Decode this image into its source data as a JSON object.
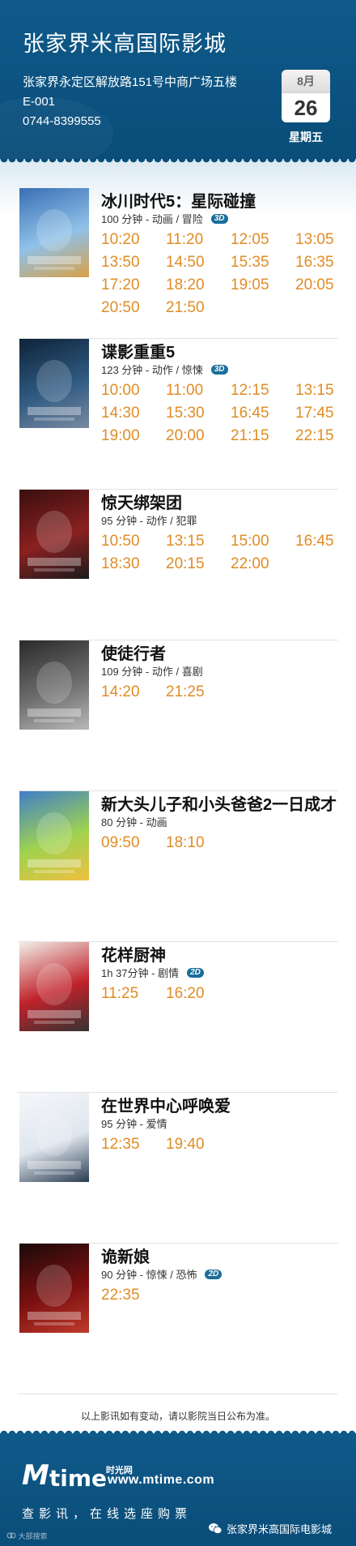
{
  "header": {
    "cinema_name": "张家界米高国际影城",
    "address": "张家界永定区解放路151号中商广场五楼E-001",
    "phone": "0744-8399555",
    "calendar": {
      "month": "8月",
      "day": "26",
      "weekday": "星期五"
    }
  },
  "movies": [
    {
      "title": "冰川时代5：星际碰撞",
      "info": "100 分钟 - 动画 / 冒险",
      "badge": "3D",
      "poster": "ice-age-poster",
      "times": [
        "10:20",
        "11:20",
        "12:05",
        "13:05",
        "13:50",
        "14:50",
        "15:35",
        "16:35",
        "17:20",
        "18:20",
        "19:05",
        "20:05",
        "20:50",
        "21:50"
      ]
    },
    {
      "title": "谍影重重5",
      "info": "123 分钟 - 动作 / 惊悚",
      "badge": "3D",
      "poster": "jason-bourne-poster",
      "times": [
        "10:00",
        "11:00",
        "12:15",
        "13:15",
        "14:30",
        "15:30",
        "16:45",
        "17:45",
        "19:00",
        "20:00",
        "21:15",
        "22:15"
      ]
    },
    {
      "title": "惊天绑架团",
      "info": "95 分钟 - 动作 / 犯罪",
      "badge": "",
      "poster": "kidnapping-poster",
      "times": [
        "10:50",
        "13:15",
        "15:00",
        "16:45",
        "18:30",
        "20:15",
        "22:00"
      ]
    },
    {
      "title": "使徒行者",
      "info": "109 分钟 - 动作 / 喜剧",
      "badge": "",
      "poster": "line-walker-poster",
      "times": [
        "14:20",
        "21:25"
      ]
    },
    {
      "title": "新大头儿子和小头爸爸2一日成才",
      "info": "80 分钟 - 动画",
      "badge": "",
      "poster": "big-head-son-poster",
      "times": [
        "09:50",
        "18:10"
      ]
    },
    {
      "title": "花样厨神",
      "info": "1h 37分钟 - 剧情",
      "badge": "2D",
      "poster": "chef-poster",
      "times": [
        "11:25",
        "16:20"
      ]
    },
    {
      "title": "在世界中心呼唤爱",
      "info": "95 分钟 - 爱情",
      "badge": "",
      "poster": "crying-out-love-poster",
      "times": [
        "12:35",
        "19:40"
      ]
    },
    {
      "title": "诡新娘",
      "info": "90 分钟 - 惊悚 / 恐怖",
      "badge": "2D",
      "poster": "ghost-bride-poster",
      "times": [
        "22:35"
      ]
    }
  ],
  "notice": "以上影讯如有变动，请以影院当日公布为准。",
  "footer": {
    "logo_m": "M",
    "logo_time": "time",
    "logo_cn": "时光网",
    "site": "www.mtime.com",
    "slogan": "查影讯，在线选座购票",
    "wechat_account": "张家界米高国际电影城",
    "watermark": "大部搜索"
  },
  "colors": {
    "header_blue": "#0b5280",
    "time_orange": "#e08c25",
    "badge_blue": "#1a6e9a"
  }
}
